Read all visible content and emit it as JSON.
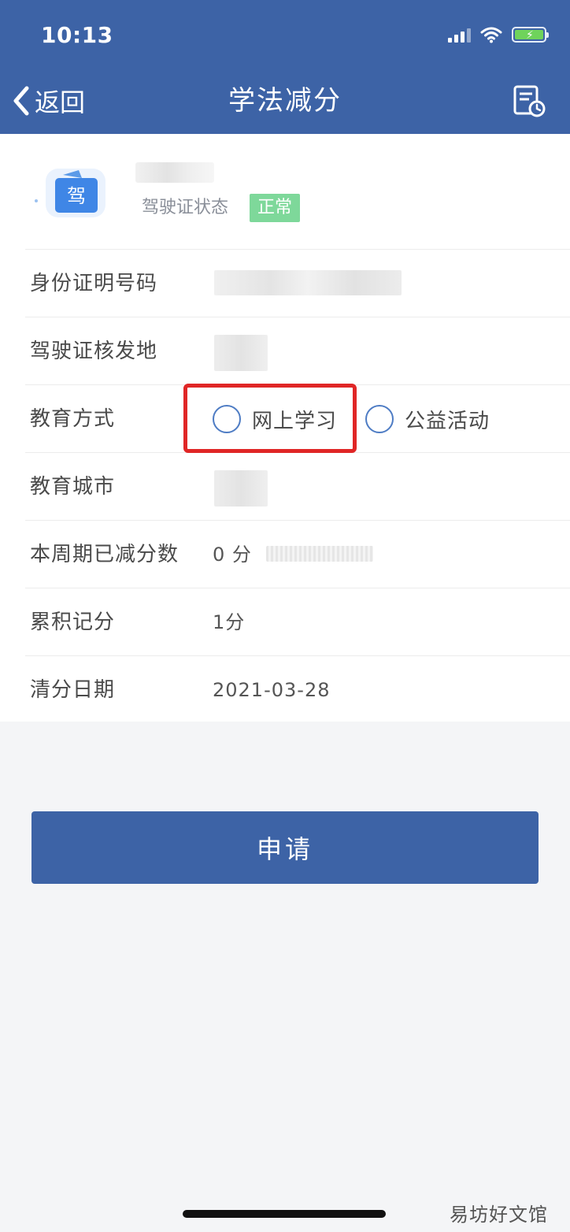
{
  "status_bar": {
    "time": "10:13"
  },
  "nav": {
    "back_label": "返回",
    "title": "学法减分"
  },
  "profile": {
    "license_icon_char": "驾",
    "status_label": "驾驶证状态",
    "status_value": "正常"
  },
  "rows": {
    "id_number": {
      "label": "身份证明号码"
    },
    "issue_place": {
      "label": "驾驶证核发地"
    },
    "education": {
      "label": "教育方式",
      "options": [
        "网上学习",
        "公益活动"
      ]
    },
    "education_city": {
      "label": "教育城市"
    },
    "deducted": {
      "label": "本周期已减分数",
      "value": "0 分"
    },
    "accumulated": {
      "label": "累积记分",
      "value": "1分"
    },
    "clear_date": {
      "label": "清分日期",
      "value": "2021-03-28"
    }
  },
  "apply_button": "申请",
  "watermark": "易坊好文馆",
  "colors": {
    "primary": "#3d63a6",
    "status_badge": "#7ed89a",
    "highlight": "#e02626",
    "radio_border": "#4e7cc4"
  }
}
